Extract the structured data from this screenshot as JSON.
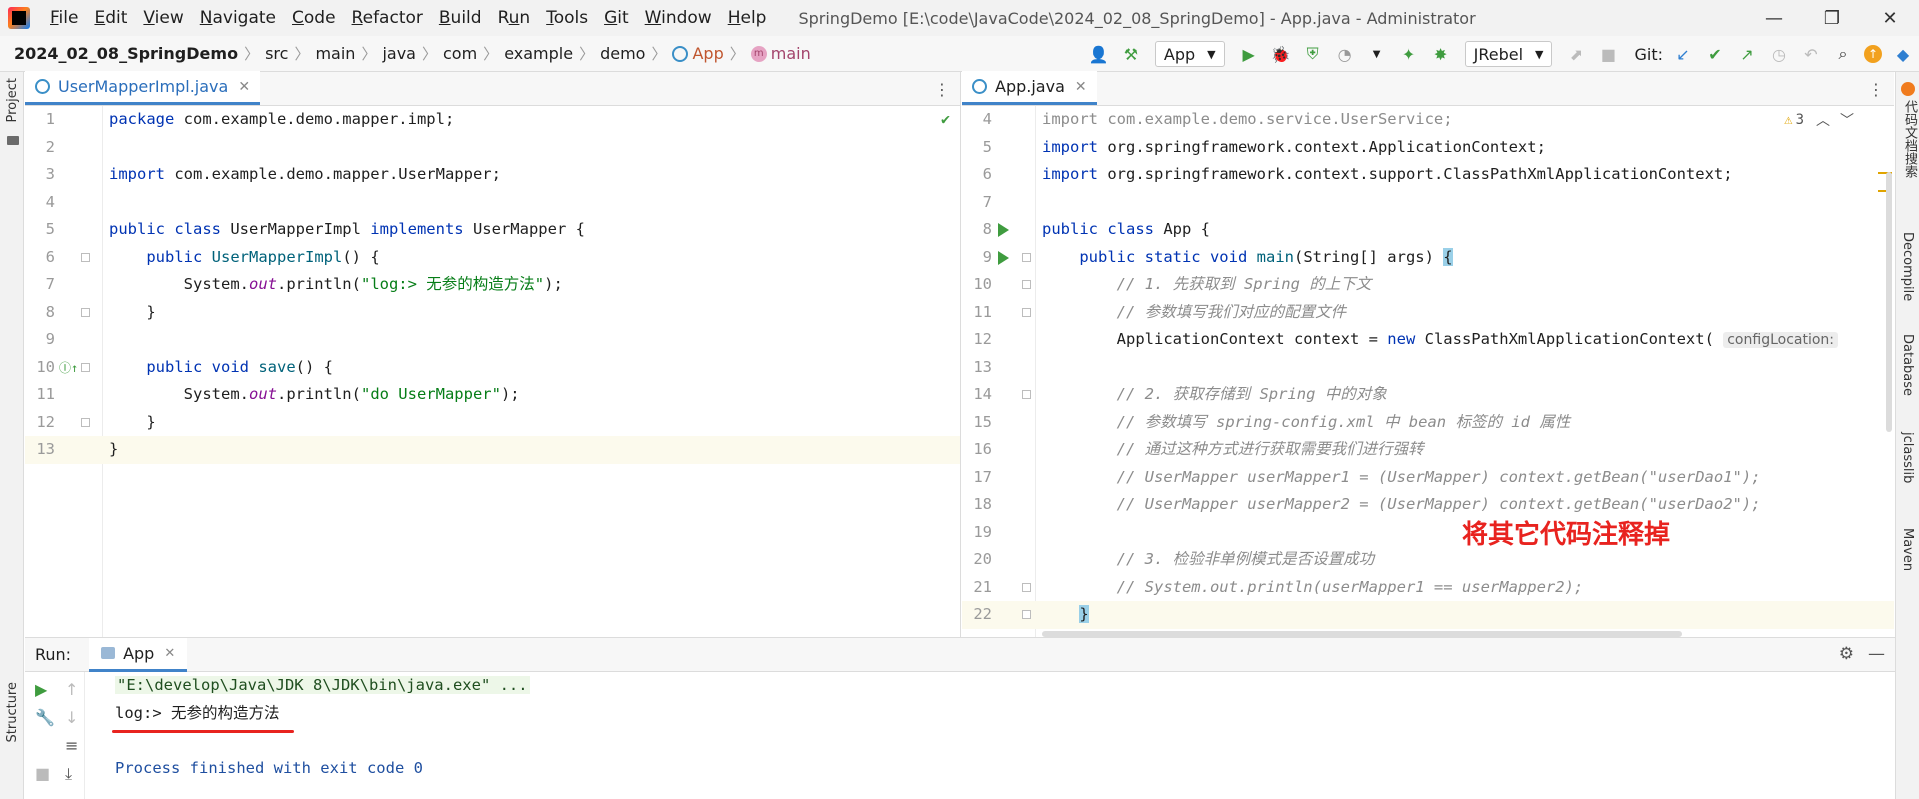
{
  "titlebar": {
    "menu": [
      {
        "label": "File",
        "u": "F"
      },
      {
        "label": "Edit",
        "u": "E"
      },
      {
        "label": "View",
        "u": "V"
      },
      {
        "label": "Navigate",
        "u": "N"
      },
      {
        "label": "Code",
        "u": "C"
      },
      {
        "label": "Refactor",
        "u": "R"
      },
      {
        "label": "Build",
        "u": "B"
      },
      {
        "label": "Run",
        "u": "u"
      },
      {
        "label": "Tools",
        "u": "T"
      },
      {
        "label": "Git",
        "u": "G"
      },
      {
        "label": "Window",
        "u": "W"
      },
      {
        "label": "Help",
        "u": "H"
      }
    ],
    "window_title": "SpringDemo [E:\\code\\JavaCode\\2024_02_08_SpringDemo] - App.java - Administrator",
    "minimize": "—",
    "restore": "❐",
    "close": "✕"
  },
  "navbar": {
    "crumbs": [
      "2024_02_08_SpringDemo",
      "src",
      "main",
      "java",
      "com",
      "example",
      "demo"
    ],
    "class_crumb": "App",
    "method_crumb": "main",
    "run_config": "App",
    "jrebel": "JRebel",
    "git_label": "Git:"
  },
  "left_strip": {
    "project": "Project",
    "structure": "Structure"
  },
  "right_strip": {
    "items": [
      "代码文档搜索",
      "Decompile",
      "Database",
      "jclasslib",
      "Maven"
    ]
  },
  "left_editor": {
    "tab_label": "UserMapperImpl.java",
    "lines": [
      {
        "n": "1",
        "html": "<span class=\"kw\">package</span> com.example.demo.mapper.impl;"
      },
      {
        "n": "2",
        "html": ""
      },
      {
        "n": "3",
        "html": "<span class=\"kw\">import</span> com.example.demo.mapper.UserMapper;"
      },
      {
        "n": "4",
        "html": ""
      },
      {
        "n": "5",
        "html": "<span class=\"kw\">public class</span> UserMapperImpl <span class=\"kw\">implements</span> UserMapper {"
      },
      {
        "n": "6",
        "html": "    <span class=\"kw\">public</span> <span class=\"mth\">UserMapperImpl</span>() {"
      },
      {
        "n": "7",
        "html": "        System.<span class=\"fld\">out</span>.println(<span class=\"str\">\"log:&gt; 无参的构造方法\"</span>);"
      },
      {
        "n": "8",
        "html": "    }"
      },
      {
        "n": "9",
        "html": ""
      },
      {
        "n": "10",
        "html": "    <span class=\"kw\">public void</span> <span class=\"mth\">save</span>() {"
      },
      {
        "n": "11",
        "html": "        System.<span class=\"fld\">out</span>.println(<span class=\"str\">\"do UserMapper\"</span>);"
      },
      {
        "n": "12",
        "html": "    }"
      },
      {
        "n": "13",
        "html": "}"
      }
    ]
  },
  "right_editor": {
    "tab_label": "App.java",
    "warnings": "3",
    "lines": [
      {
        "n": "4",
        "html": "<span class=\"gray-import\">import com.example.demo.service.UserService;</span>"
      },
      {
        "n": "5",
        "html": "<span class=\"kw\">import</span> org.springframework.context.ApplicationContext;"
      },
      {
        "n": "6",
        "html": "<span class=\"kw\">import</span> org.springframework.context.support.ClassPathXmlApplicationContext;"
      },
      {
        "n": "7",
        "html": ""
      },
      {
        "n": "8",
        "html": "<span class=\"kw\">public class</span> App {"
      },
      {
        "n": "9",
        "html": "    <span class=\"kw\">public static void</span> <span class=\"mth\">main</span>(String[] args) <span class=\"brace-hl\">{</span>"
      },
      {
        "n": "10",
        "html": "        <span class=\"cmt\">// 1. 先获取到 Spring 的上下文</span>"
      },
      {
        "n": "11",
        "html": "        <span class=\"cmt\">// 参数填写我们对应的配置文件</span>"
      },
      {
        "n": "12",
        "html": "        ApplicationContext context = <span class=\"kw\">new</span> ClassPathXmlApplicationContext( <span class=\"hint\">configLocation:</span>"
      },
      {
        "n": "13",
        "html": ""
      },
      {
        "n": "14",
        "html": "        <span class=\"cmt\">// 2. 获取存储到 Spring 中的对象</span>"
      },
      {
        "n": "15",
        "html": "        <span class=\"cmt\">// 参数填写 spring-config.xml 中 bean 标签的 id 属性</span>"
      },
      {
        "n": "16",
        "html": "        <span class=\"cmt\">// 通过这种方式进行获取需要我们进行强转</span>"
      },
      {
        "n": "17",
        "html": "        <span class=\"cmt\">// UserMapper userMapper1 = (UserMapper) context.getBean(\"userDao1\");</span>"
      },
      {
        "n": "18",
        "html": "        <span class=\"cmt\">// UserMapper userMapper2 = (UserMapper) context.getBean(\"userDao2\");</span>"
      },
      {
        "n": "19",
        "html": ""
      },
      {
        "n": "20",
        "html": "        <span class=\"cmt\">// 3. 检验非单例模式是否设置成功</span>"
      },
      {
        "n": "21",
        "html": "        <span class=\"cmt\">// System.out.println(userMapper1 == userMapper2);</span>"
      },
      {
        "n": "22",
        "html": "    <span class=\"brace-hl\">}</span>"
      }
    ],
    "annotation": "将其它代码注释掉"
  },
  "run_panel": {
    "title": "Run:",
    "tab_label": "App",
    "console": [
      "\"E:\\develop\\Java\\JDK 8\\JDK\\bin\\java.exe\" ...",
      "log:> 无参的构造方法",
      "",
      "Process finished with exit code 0"
    ]
  }
}
